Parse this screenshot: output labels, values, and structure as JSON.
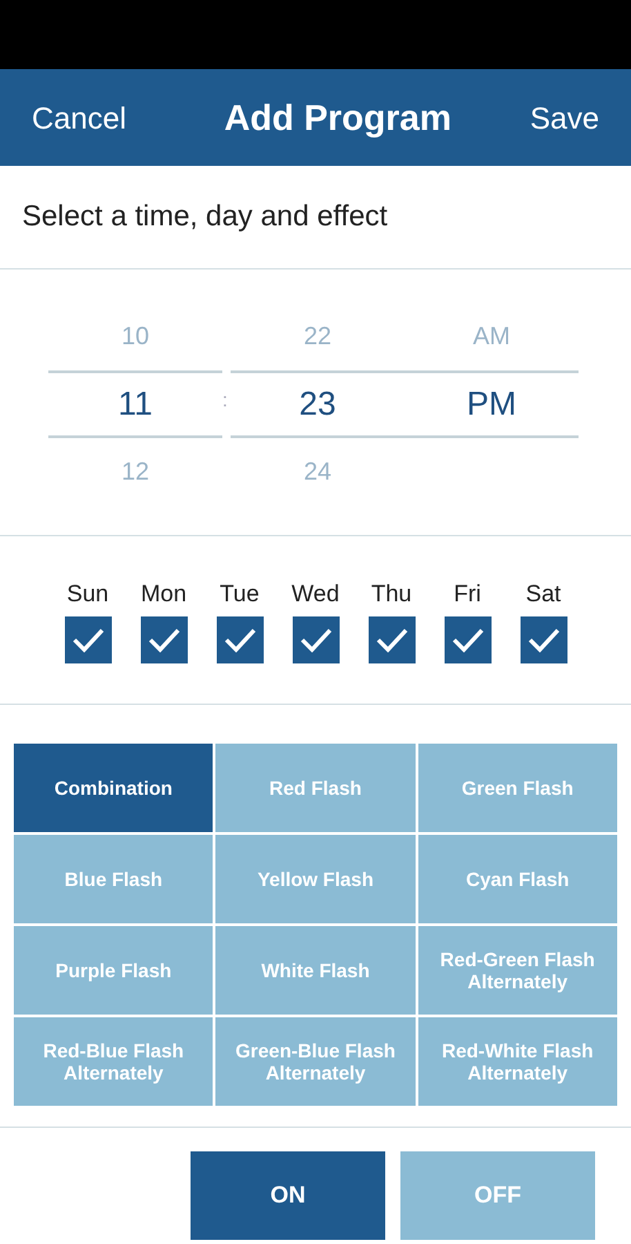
{
  "header": {
    "cancel": "Cancel",
    "title": "Add Program",
    "save": "Save"
  },
  "instruction": "Select a time, day and effect",
  "time_picker": {
    "separator": ":",
    "columns": [
      {
        "items": [
          {
            "label": "10",
            "selected": false
          },
          {
            "label": "11",
            "selected": true
          },
          {
            "label": "12",
            "selected": false
          }
        ]
      },
      {
        "items": [
          {
            "label": "22",
            "selected": false
          },
          {
            "label": "23",
            "selected": true
          },
          {
            "label": "24",
            "selected": false
          }
        ]
      },
      {
        "items": [
          {
            "label": "AM",
            "selected": false
          },
          {
            "label": "PM",
            "selected": true
          }
        ]
      }
    ]
  },
  "days": [
    {
      "label": "Sun",
      "checked": true
    },
    {
      "label": "Mon",
      "checked": true
    },
    {
      "label": "Tue",
      "checked": true
    },
    {
      "label": "Wed",
      "checked": true
    },
    {
      "label": "Thu",
      "checked": true
    },
    {
      "label": "Fri",
      "checked": true
    },
    {
      "label": "Sat",
      "checked": true
    }
  ],
  "effects": [
    {
      "label": "Combination",
      "selected": true
    },
    {
      "label": "Red Flash",
      "selected": false
    },
    {
      "label": "Green Flash",
      "selected": false
    },
    {
      "label": "Blue Flash",
      "selected": false
    },
    {
      "label": "Yellow Flash",
      "selected": false
    },
    {
      "label": "Cyan Flash",
      "selected": false
    },
    {
      "label": "Purple Flash",
      "selected": false
    },
    {
      "label": "White Flash",
      "selected": false
    },
    {
      "label": "Red-Green Flash Alternately",
      "selected": false
    },
    {
      "label": "Red-Blue Flash Alternately",
      "selected": false
    },
    {
      "label": "Green-Blue Flash Alternately",
      "selected": false
    },
    {
      "label": "Red-White Flash Alternately",
      "selected": false
    }
  ],
  "power": [
    {
      "label": "ON",
      "selected": true
    },
    {
      "label": "OFF",
      "selected": false
    }
  ]
}
